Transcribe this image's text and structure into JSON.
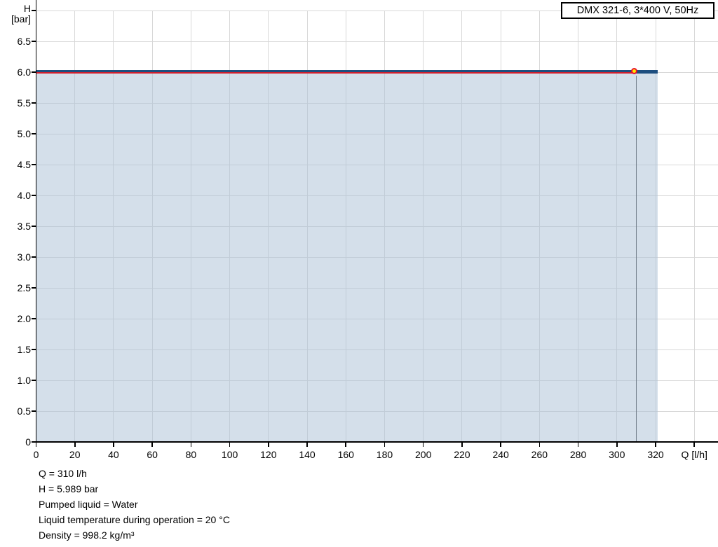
{
  "legend": {
    "label": "DMX 321-6, 3*400 V, 50Hz"
  },
  "info_lines": [
    "Q = 310 l/h",
    "H = 5.989 bar",
    "Pumped liquid = Water",
    "Liquid temperature during operation = 20 °C",
    "Density = 998.2 kg/m³"
  ],
  "chart_data": {
    "type": "line",
    "title": "DMX 321-6 pump performance curve",
    "legend_position": "top-right",
    "grid": true,
    "x_axis": {
      "label": "Q [l/h]",
      "min": 0,
      "max": 343,
      "tick_step": 20,
      "tick_values": [
        0,
        20,
        40,
        60,
        80,
        100,
        120,
        140,
        160,
        180,
        200,
        220,
        240,
        260,
        280,
        300,
        320,
        340
      ],
      "tick_labels": [
        "0",
        "20",
        "40",
        "60",
        "80",
        "100",
        "120",
        "140",
        "160",
        "180",
        "200",
        "220",
        "240",
        "260",
        "280",
        "300",
        "320",
        ""
      ]
    },
    "y_axis": {
      "label_line1": "H",
      "label_line2": "[bar]",
      "min": 0,
      "max": 7.0,
      "tick_step": 0.5,
      "tick_values": [
        0,
        0.5,
        1.0,
        1.5,
        2.0,
        2.5,
        3.0,
        3.5,
        4.0,
        4.5,
        5.0,
        5.5,
        6.0,
        6.5,
        7.0
      ],
      "tick_labels": [
        "0",
        "0.5",
        "1.0",
        "1.5",
        "2.0",
        "2.5",
        "3.0",
        "3.5",
        "4.0",
        "4.5",
        "5.0",
        "5.5",
        "6.0",
        "6.5",
        ""
      ]
    },
    "series": [
      {
        "name": "DMX 321-6, 3*400 V, 50Hz",
        "role": "pump-curve",
        "color": "#1d4e7f",
        "points": [
          {
            "q": 0,
            "h": 6.0
          },
          {
            "q": 321,
            "h": 6.0
          }
        ]
      },
      {
        "name": "operating-line",
        "role": "duty-line",
        "color": "#cf1f2e",
        "points": [
          {
            "q": 0,
            "h": 5.989
          },
          {
            "q": 310,
            "h": 5.989
          }
        ]
      }
    ],
    "area_fill": {
      "q_from": 0,
      "q_to": 321,
      "h_top": 6.0,
      "color": "rgba(170,192,214,0.5)"
    },
    "operating_point": {
      "q": 310,
      "h": 5.989,
      "marker_fill": "#ffe600",
      "marker_ring": "#e8112d",
      "drop_line_color": "#717d89"
    },
    "colors": {
      "gridline": "#d8d8d8",
      "axis": "#000000",
      "background": "#ffffff"
    }
  }
}
